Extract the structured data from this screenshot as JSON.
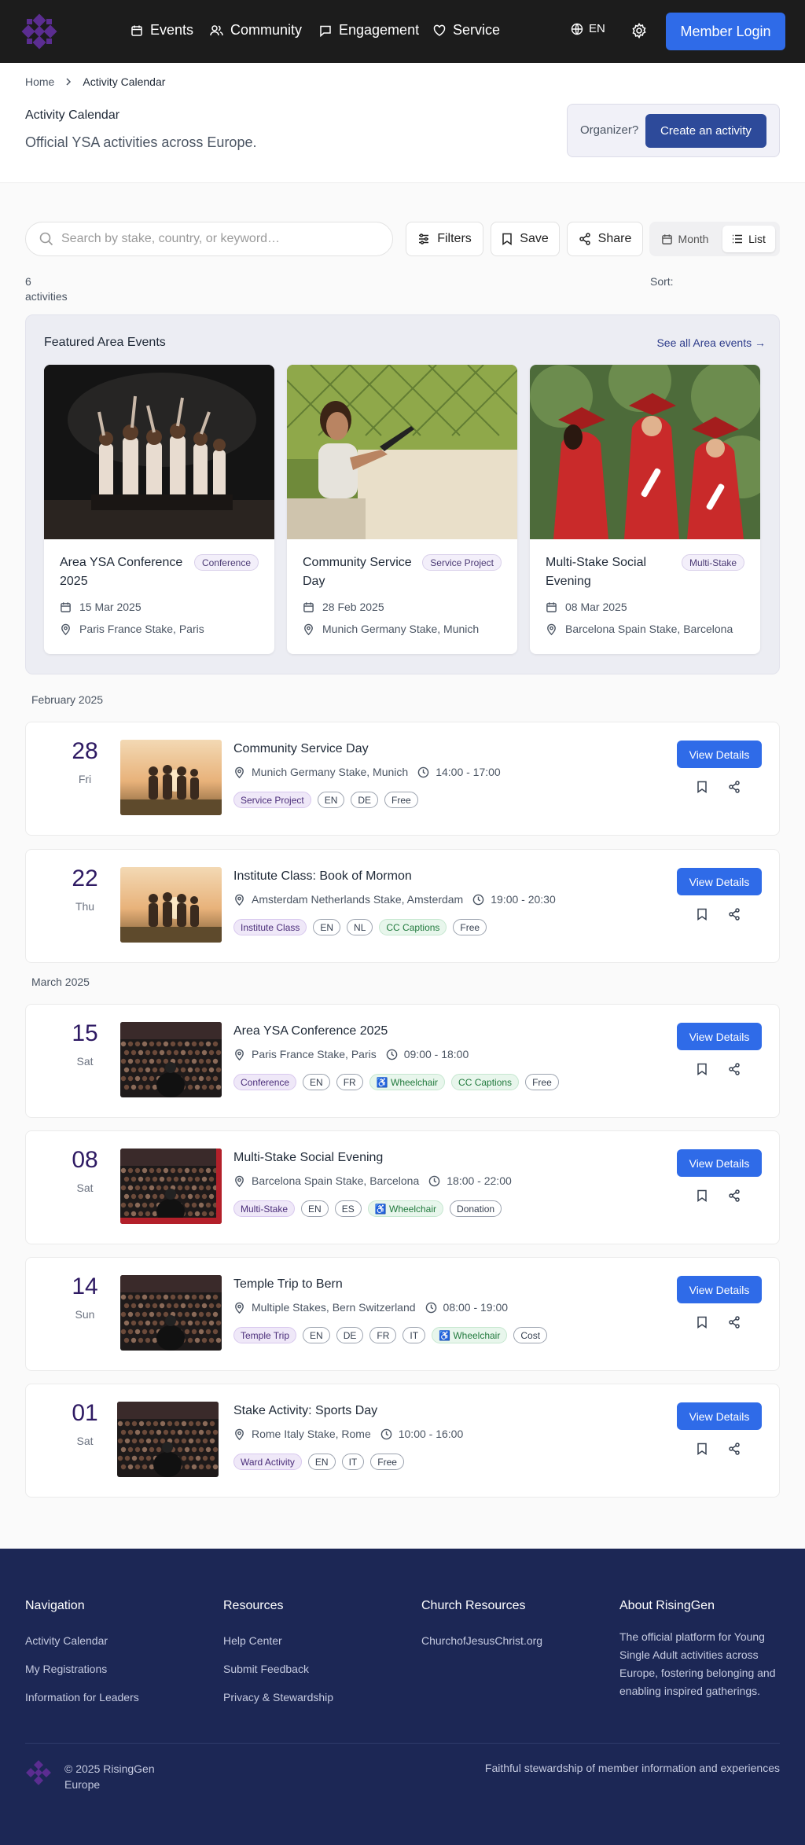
{
  "header": {
    "nav": [
      {
        "label": "Events",
        "icon": "calendar-icon"
      },
      {
        "label": "Community",
        "icon": "users-icon"
      },
      {
        "label": "Engagement",
        "icon": "chat-icon"
      },
      {
        "label": "Service",
        "icon": "heart-icon"
      }
    ],
    "language": "EN",
    "login_label": "Member Login"
  },
  "breadcrumb": {
    "home": "Home",
    "current": "Activity Calendar"
  },
  "page": {
    "title": "Activity Calendar",
    "subtitle": "Official YSA activities across Europe.",
    "organizer_prompt": "Organizer?",
    "create_label": "Create an activity"
  },
  "toolbar": {
    "search_placeholder": "Search by stake, country, or keyword…",
    "filters_label": "Filters",
    "save_label": "Save",
    "share_label": "Share",
    "view_month": "Month",
    "view_list": "List",
    "active_view": "List"
  },
  "results": {
    "count": "6",
    "unit": "activities",
    "sort_label": "Sort:"
  },
  "featured": {
    "heading": "Featured Area Events",
    "see_all": "See all Area events →",
    "cards": [
      {
        "title": "Area YSA Conference 2025",
        "badge": "Conference",
        "date": "15 Mar 2025",
        "location": "Paris France Stake, Paris"
      },
      {
        "title": "Community Service Day",
        "badge": "Service Project",
        "date": "28 Feb 2025",
        "location": "Munich Germany Stake, Munich"
      },
      {
        "title": "Multi-Stake Social Evening",
        "badge": "Multi-Stake",
        "date": "08 Mar 2025",
        "location": "Barcelona Spain Stake, Barcelona"
      }
    ]
  },
  "months": [
    "February 2025",
    "March 2025"
  ],
  "events": [
    {
      "day": "28",
      "dow": "Fri",
      "title": "Community Service Day",
      "location": "Munich Germany Stake, Munich",
      "time": "14:00 - 17:00",
      "type": "Service Project",
      "langs": [
        "EN",
        "DE"
      ],
      "access": [],
      "cost": "Free"
    },
    {
      "day": "22",
      "dow": "Thu",
      "title": "Institute Class: Book of Mormon",
      "location": "Amsterdam Netherlands Stake, Amsterdam",
      "time": "19:00 - 20:30",
      "type": "Institute Class",
      "langs": [
        "EN",
        "NL"
      ],
      "access": [
        "CC Captions"
      ],
      "cost": "Free"
    },
    {
      "day": "15",
      "dow": "Sat",
      "title": "Area YSA Conference 2025",
      "location": "Paris France Stake, Paris",
      "time": "09:00 - 18:00",
      "type": "Conference",
      "langs": [
        "EN",
        "FR"
      ],
      "access": [
        "♿ Wheelchair",
        "CC Captions"
      ],
      "cost": "Free"
    },
    {
      "day": "08",
      "dow": "Sat",
      "title": "Multi-Stake Social Evening",
      "location": "Barcelona Spain Stake, Barcelona",
      "time": "18:00 - 22:00",
      "type": "Multi-Stake",
      "langs": [
        "EN",
        "ES"
      ],
      "access": [
        "♿ Wheelchair"
      ],
      "cost": "Donation"
    },
    {
      "day": "14",
      "dow": "Sun",
      "title": "Temple Trip to Bern",
      "location": "Multiple Stakes, Bern Switzerland",
      "time": "08:00 - 19:00",
      "type": "Temple Trip",
      "langs": [
        "EN",
        "DE",
        "FR",
        "IT"
      ],
      "access": [
        "♿ Wheelchair"
      ],
      "cost": "Cost"
    },
    {
      "day": "01",
      "dow": "Sat",
      "title": "Stake Activity: Sports Day",
      "location": "Rome Italy Stake, Rome",
      "time": "10:00 - 16:00",
      "type": "Ward Activity",
      "langs": [
        "EN",
        "IT"
      ],
      "access": [],
      "cost": "Free"
    }
  ],
  "event_action_label": "View Details",
  "footer": {
    "columns": [
      {
        "heading": "Navigation",
        "links": [
          "Activity Calendar",
          "My Registrations",
          "Information for Leaders"
        ]
      },
      {
        "heading": "Resources",
        "links": [
          "Help Center",
          "Submit Feedback",
          "Privacy & Stewardship"
        ]
      },
      {
        "heading": "Church Resources",
        "links": [
          "ChurchofJesusChrist.org"
        ]
      }
    ],
    "about_heading": "About RisingGen",
    "about_text": "The official platform for Young Single Adult activities across Europe, fostering belonging and enabling inspired gatherings.",
    "copyright": "© 2025 RisingGen Europe",
    "tagline": "Faithful stewardship of member information and experiences"
  },
  "colors": {
    "primary": "#2f6be8",
    "dark_header": "#1c1c1c",
    "footer": "#1c2755",
    "accent_purple": "#2e1a63",
    "logo": "#5b2d91"
  }
}
